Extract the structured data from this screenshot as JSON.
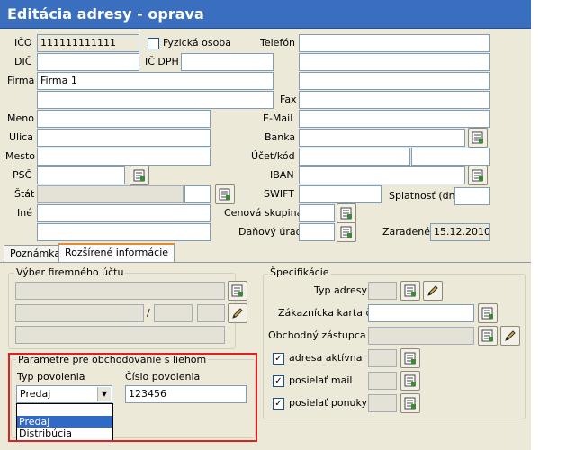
{
  "window": {
    "title": "Editácia adresy   -   oprava"
  },
  "labels": {
    "ico": "IČO",
    "dic": "DIČ",
    "firma": "Firma",
    "meno": "Meno",
    "ulica": "Ulica",
    "mesto": "Mesto",
    "psc": "PSČ",
    "stat": "Štát",
    "ine": "Iné",
    "fyzicka_osoba": "Fyzická osoba",
    "ic_dph": "IČ DPH",
    "telefon": "Telefón",
    "fax": "Fax",
    "email": "E-Mail",
    "banka": "Banka",
    "ucet_kod": "Účet/kód",
    "iban": "IBAN",
    "swift": "SWIFT",
    "splatnost": "Splatnosť (dni)",
    "cenova_skupina": "Cenová skupina",
    "danovy_urad": "Daňový úrad",
    "zaradene": "Zaradené"
  },
  "values": {
    "ico": "111111111111",
    "firma": "Firma 1",
    "zaradene": "15.12.2010",
    "fyzicka_osoba_checked": false
  },
  "tabs": [
    {
      "label": "Poznámka",
      "active": false
    },
    {
      "label": "Rozšírené informácie",
      "active": true
    }
  ],
  "vyber_uctu": {
    "title": "Výber firemného účtu",
    "separator": "/"
  },
  "specifikacie": {
    "title": "Špecifikácie",
    "typ_adresy": "Typ adresy",
    "zakaznicka_karta": "Zákaznícka karta č.",
    "obchodny_zastupca": "Obchodný zástupca č.",
    "adresa_aktivna": "adresa aktívna",
    "posielat_mail": "posielať mail",
    "posielat_ponuky": "posielať ponuky",
    "adresa_aktivna_checked": true,
    "posielat_mail_checked": true,
    "posielat_ponuky_checked": true
  },
  "parametre": {
    "title": "Parametre pre obchodovanie s liehom",
    "typ_povolenia_label": "Typ povolenia",
    "cislo_povolenia_label": "Číslo povolenia",
    "typ_povolenia_value": "Predaj",
    "cislo_povolenia_value": "123456",
    "options": [
      "Predaj",
      "Distribúcia"
    ],
    "selected_option": "Predaj"
  },
  "colors": {
    "titlebar": "#3a6fc0",
    "window_bg": "#ece9d8",
    "highlight_border": "#e02020",
    "selection": "#316ac5"
  },
  "icons": {
    "lookup": "notepad-lookup-icon",
    "edit": "pencil-icon",
    "dropdown": "chevron-down-icon"
  }
}
